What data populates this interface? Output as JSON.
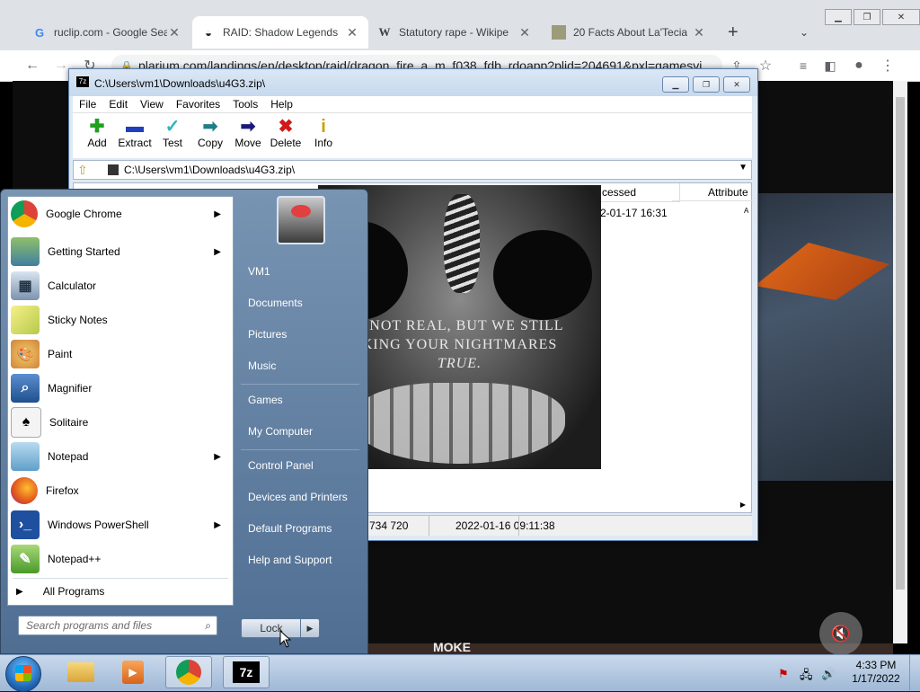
{
  "browser": {
    "tabs": [
      {
        "label": "ruclip.com - Google Sea",
        "icon": "google-icon"
      },
      {
        "label": "RAID: Shadow Legends",
        "icon": "raid-icon"
      },
      {
        "label": "Statutory rape - Wikipe",
        "icon": "wikipedia-icon"
      },
      {
        "label": "20 Facts About La'Tecia",
        "icon": "image-icon"
      }
    ],
    "url": "plarium.com/landings/en/desktop/raid/dragon_fire_a_m_f038_fdb_rdoapp?plid=204691&pxl=gamesvi..."
  },
  "zip": {
    "title": "C:\\Users\\vm1\\Downloads\\u4G3.zip\\",
    "menu": [
      "File",
      "Edit",
      "View",
      "Favorites",
      "Tools",
      "Help"
    ],
    "tools": [
      "Add",
      "Extract",
      "Test",
      "Copy",
      "Move",
      "Delete",
      "Info"
    ],
    "address": "C:\\Users\\vm1\\Downloads\\u4G3.zip\\",
    "columns": {
      "accessed": "cessed",
      "attributes": "Attribute"
    },
    "row": {
      "accessed": "2-01-17 16:31",
      "attr": "A"
    },
    "status": {
      "size": "734 720",
      "date": "2022-01-16 09:11:38"
    }
  },
  "popup": {
    "line1": "E NOT REAL, BUT WE STILL",
    "line2": "KING YOUR NIGHTMARES",
    "line3": "TRUE."
  },
  "startmenu": {
    "programs": [
      {
        "label": "Google Chrome",
        "submenu": true
      },
      {
        "label": "Getting Started",
        "submenu": true
      },
      {
        "label": "Calculator",
        "submenu": false
      },
      {
        "label": "Sticky Notes",
        "submenu": false
      },
      {
        "label": "Paint",
        "submenu": false
      },
      {
        "label": "Magnifier",
        "submenu": false
      },
      {
        "label": "Solitaire",
        "submenu": false
      },
      {
        "label": "Notepad",
        "submenu": true
      },
      {
        "label": "Firefox",
        "submenu": false
      },
      {
        "label": "Windows PowerShell",
        "submenu": true
      },
      {
        "label": "Notepad++",
        "submenu": false
      }
    ],
    "all_programs": "All Programs",
    "search_placeholder": "Search programs and files",
    "right": [
      "VM1",
      "Documents",
      "Pictures",
      "Music",
      "Games",
      "My Computer",
      "Control Panel",
      "Devices and Printers",
      "Default Programs",
      "Help and Support"
    ],
    "lock": "Lock"
  },
  "taskbar": {
    "time": "4:33 PM",
    "date": "1/17/2022"
  },
  "page_bottom_text": "MOKE"
}
